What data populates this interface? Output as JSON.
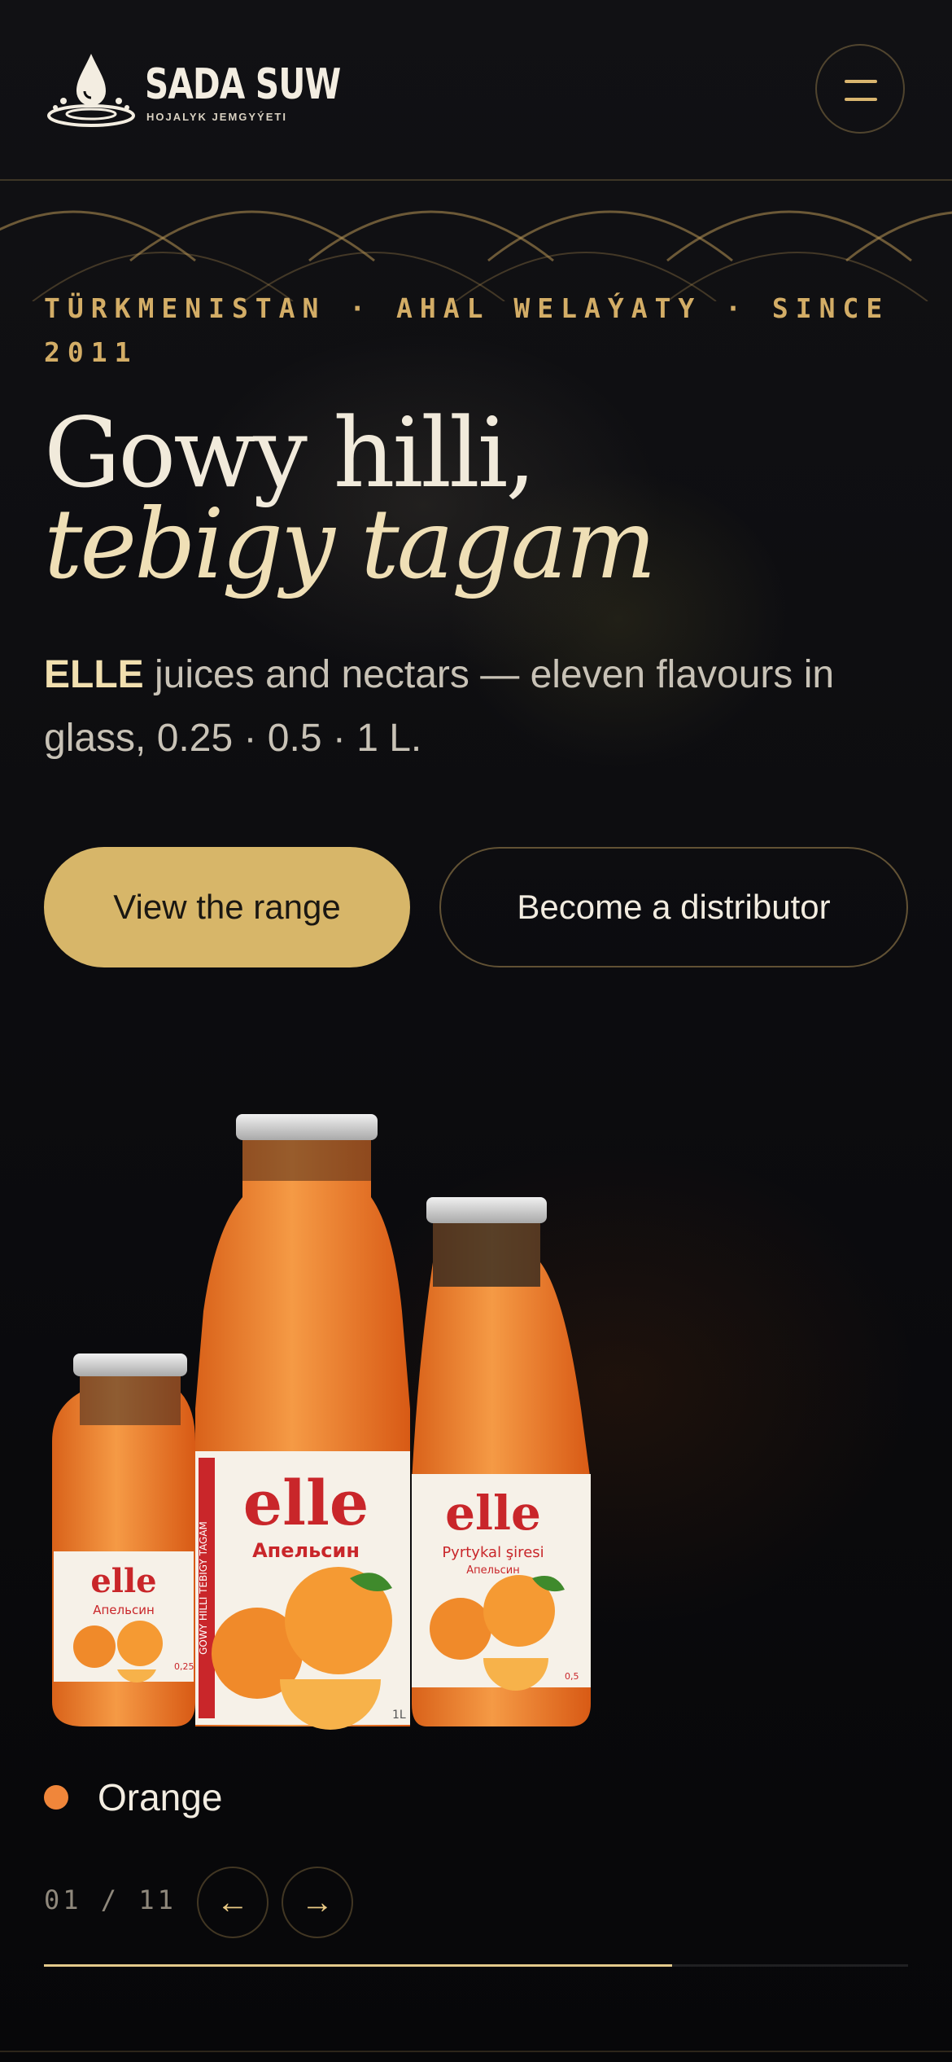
{
  "header": {
    "brand_name": "SADA SUW",
    "brand_sub": "HOJALYK JEMGYÝETI",
    "menu_icon": "menu-icon"
  },
  "hero": {
    "eyebrow": "TÜRKMENISTAN · AHAL WELAÝATY · SINCE 2011",
    "title_line1": "Gowy hilli,",
    "title_line2": "tebigy tagam",
    "lede_brand": "ELLE",
    "lede_text": " juices and nectars — eleven flavours in glass, 0.25 · 0.5 · 1 L.",
    "primary_cta": "View the range",
    "secondary_cta": "Become a distributor"
  },
  "product": {
    "brand_label": "elle",
    "flavour_ru": "Апельсин",
    "flavour_tm": "Pyrtykal şiresi",
    "tagline": "GOWY HILLI TEBIGY TAGAM",
    "size_small": "0,25",
    "size_medium": "0,5",
    "size_large": "1L",
    "flavour_name": "Orange",
    "flavour_color": "#f0863a"
  },
  "carousel": {
    "counter": "01 / 11",
    "prev_icon": "←",
    "next_icon": "→",
    "progress": 0.727
  },
  "colors": {
    "accent": "#d7b669",
    "background": "#0b0b0d",
    "juice": "#f07a2a",
    "label_red": "#c9262a"
  }
}
